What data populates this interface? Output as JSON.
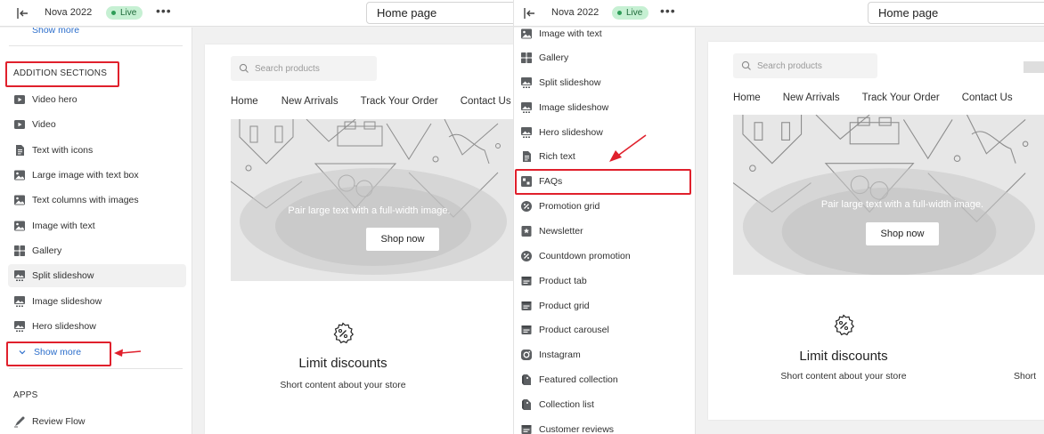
{
  "left": {
    "topbar": {
      "store_name": "Nova 2022",
      "status": "Live",
      "page_select": "Home page"
    },
    "sidebar": {
      "show_more_top": "Show more",
      "addition_title": "ADDITION SECTIONS",
      "items": [
        {
          "label": "Video hero",
          "icon": "video-icon"
        },
        {
          "label": "Video",
          "icon": "video-icon"
        },
        {
          "label": "Text with icons",
          "icon": "document-icon"
        },
        {
          "label": "Large image with text box",
          "icon": "image-icon"
        },
        {
          "label": "Text columns with images",
          "icon": "image-icon"
        },
        {
          "label": "Image with text",
          "icon": "image-icon"
        },
        {
          "label": "Gallery",
          "icon": "grid-icon"
        },
        {
          "label": "Split slideshow",
          "icon": "slideshow-icon"
        },
        {
          "label": "Image slideshow",
          "icon": "slideshow-icon"
        },
        {
          "label": "Hero slideshow",
          "icon": "slideshow-icon"
        }
      ],
      "show_more": "Show more",
      "apps_title": "APPS",
      "app_item": "Review Flow"
    },
    "preview": {
      "search_placeholder": "Search products",
      "nav": [
        "Home",
        "New Arrivals",
        "Track Your Order",
        "Contact Us"
      ],
      "hero_text": "Pair large text with a full-width image.",
      "hero_button": "Shop now",
      "promo_title": "Limit discounts",
      "promo_sub": "Short content about your store"
    }
  },
  "right": {
    "topbar": {
      "store_name": "Nova 2022",
      "status": "Live",
      "page_select": "Home page"
    },
    "sidebar": {
      "items": [
        {
          "label": "Image with text",
          "icon": "image-icon"
        },
        {
          "label": "Gallery",
          "icon": "grid-icon"
        },
        {
          "label": "Split slideshow",
          "icon": "slideshow-icon"
        },
        {
          "label": "Image slideshow",
          "icon": "slideshow-icon"
        },
        {
          "label": "Hero slideshow",
          "icon": "slideshow-icon"
        },
        {
          "label": "Rich text",
          "icon": "document-icon"
        },
        {
          "label": "FAQs",
          "icon": "faq-icon"
        },
        {
          "label": "Promotion grid",
          "icon": "discount-icon"
        },
        {
          "label": "Newsletter",
          "icon": "star-icon"
        },
        {
          "label": "Countdown promotion",
          "icon": "discount-icon"
        },
        {
          "label": "Product tab",
          "icon": "product-icon"
        },
        {
          "label": "Product grid",
          "icon": "product-icon"
        },
        {
          "label": "Product carousel",
          "icon": "product-icon"
        },
        {
          "label": "Instagram",
          "icon": "instagram-icon"
        },
        {
          "label": "Featured collection",
          "icon": "collection-icon"
        },
        {
          "label": "Collection list",
          "icon": "collection-icon"
        },
        {
          "label": "Customer reviews",
          "icon": "product-icon"
        }
      ]
    },
    "preview": {
      "search_placeholder": "Search products",
      "nav": [
        "Home",
        "New Arrivals",
        "Track Your Order",
        "Contact Us"
      ],
      "hero_text": "Pair large text with a full-width image.",
      "hero_button": "Shop now",
      "promo_title": "Limit discounts",
      "promo_sub": "Short content about your store",
      "promo_sub_partial": "Short"
    }
  },
  "colors": {
    "highlight": "#e0202c",
    "link": "#2c6ecb",
    "live_bg": "#c6f0d3"
  }
}
